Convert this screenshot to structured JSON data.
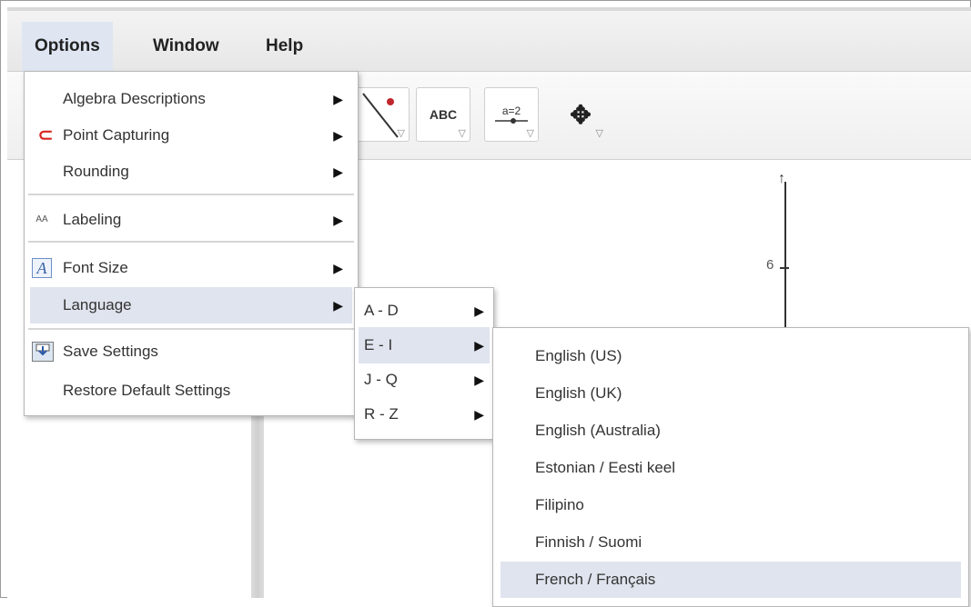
{
  "menubar": {
    "items": [
      {
        "label": "Options"
      },
      {
        "label": "Window"
      },
      {
        "label": "Help"
      }
    ]
  },
  "toolbar": {
    "tools": [
      {
        "icon": "line-through-point-icon"
      },
      {
        "icon": "text-icon",
        "label": "ABC"
      },
      {
        "icon": "slider-icon",
        "label": "a=2"
      },
      {
        "icon": "move-graphics-view-icon"
      }
    ]
  },
  "graphics": {
    "axis_tick_label": "6"
  },
  "options_menu": {
    "items": [
      {
        "label": "Algebra Descriptions"
      },
      {
        "label": "Point Capturing",
        "icon": "magnet-icon"
      },
      {
        "label": "Rounding"
      },
      {
        "label": "Labeling",
        "icon": "labeling-icon",
        "icon_text": "AA"
      },
      {
        "label": "Font Size",
        "icon": "font-size-icon",
        "icon_text": "A"
      },
      {
        "label": "Language"
      },
      {
        "label": "Save Settings",
        "icon": "save-settings-icon"
      },
      {
        "label": "Restore Default Settings"
      }
    ]
  },
  "language_menu": {
    "items": [
      {
        "label": "A - D"
      },
      {
        "label": "E - I"
      },
      {
        "label": "J - Q"
      },
      {
        "label": "R - Z"
      }
    ]
  },
  "ei_menu": {
    "items": [
      {
        "label": "English (US)"
      },
      {
        "label": "English (UK)"
      },
      {
        "label": "English (Australia)"
      },
      {
        "label": "Estonian / Eesti keel"
      },
      {
        "label": "Filipino"
      },
      {
        "label": "Finnish / Suomi"
      },
      {
        "label": "French / Français"
      }
    ]
  },
  "colors": {
    "highlight": "#dfe4ee",
    "menu_active": "#dfe6f2",
    "magnet": "#d7261e",
    "point": "#c0262d"
  }
}
